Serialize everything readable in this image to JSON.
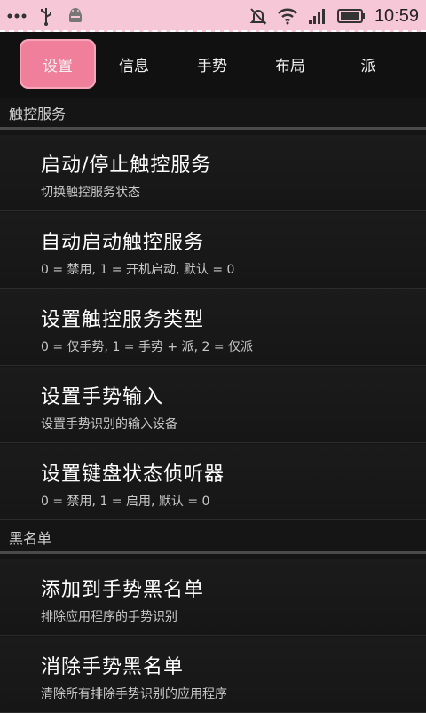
{
  "status_bar": {
    "time": "10:59",
    "left_icons": [
      "more-dots-icon",
      "usb-icon",
      "android-debug-icon"
    ],
    "right_icons": [
      "muted-bell-icon",
      "wifi-icon",
      "signal-icon",
      "battery-icon"
    ]
  },
  "tabs": [
    {
      "label": "设置",
      "active": true
    },
    {
      "label": "信息",
      "active": false
    },
    {
      "label": "手势",
      "active": false
    },
    {
      "label": "布局",
      "active": false
    },
    {
      "label": "派",
      "active": false
    }
  ],
  "sections": [
    {
      "header": "触控服务",
      "items": [
        {
          "title": "启动/停止触控服务",
          "summary": "切换触控服务状态"
        },
        {
          "title": "自动启动触控服务",
          "summary": "0 = 禁用, 1 = 开机启动, 默认 = 0"
        },
        {
          "title": "设置触控服务类型",
          "summary": "0 = 仅手势, 1 = 手势 + 派, 2 = 仅派"
        },
        {
          "title": "设置手势输入",
          "summary": "设置手势识别的输入设备"
        },
        {
          "title": "设置键盘状态侦听器",
          "summary": "0 = 禁用, 1 = 启用, 默认 = 0"
        }
      ]
    },
    {
      "header": "黑名单",
      "items": [
        {
          "title": "添加到手势黑名单",
          "summary": "排除应用程序的手势识别"
        },
        {
          "title": "消除手势黑名单",
          "summary": "清除所有排除手势识别的应用程序"
        }
      ]
    }
  ]
}
